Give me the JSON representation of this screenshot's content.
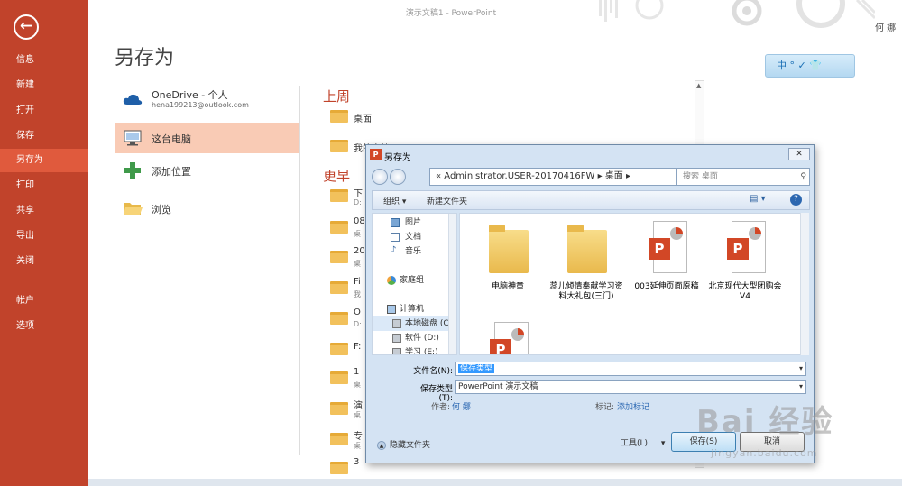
{
  "window": {
    "title": "演示文稿1 - PowerPoint",
    "user": "何 娜"
  },
  "sidebar": {
    "items": [
      {
        "label": "信息"
      },
      {
        "label": "新建"
      },
      {
        "label": "打开"
      },
      {
        "label": "保存"
      },
      {
        "label": "另存为",
        "active": true
      },
      {
        "label": "打印"
      },
      {
        "label": "共享"
      },
      {
        "label": "导出"
      },
      {
        "label": "关闭"
      },
      {
        "label": "帐户"
      },
      {
        "label": "选项"
      }
    ]
  },
  "page": {
    "title": "另存为"
  },
  "ime": {
    "label": "中 ° ✓ 👕"
  },
  "locations": {
    "onedrive": {
      "label": "OneDrive - 个人",
      "email": "hena199213@outlook.com"
    },
    "this_pc": {
      "label": "这台电脑"
    },
    "add_place": {
      "label": "添加位置"
    },
    "browse": {
      "label": "浏览"
    }
  },
  "folders": {
    "recent_week": {
      "title": "上周",
      "items": [
        {
          "name": "桌面"
        },
        {
          "name": "我的文档"
        }
      ]
    },
    "older": {
      "title": "更早",
      "items": [
        {
          "name": "下",
          "path": "D:"
        },
        {
          "name": "08",
          "path": "桌"
        },
        {
          "name": "20",
          "path": "桌"
        },
        {
          "name": "Fi",
          "path": "我"
        },
        {
          "name": "O",
          "path": "D:"
        },
        {
          "name": "F:",
          "path": ""
        },
        {
          "name": "1",
          "path": "桌"
        },
        {
          "name": "演",
          "path": "桌"
        },
        {
          "name": "专",
          "path": "桌"
        },
        {
          "name": "3",
          "path": ""
        }
      ]
    }
  },
  "dialog": {
    "title": "另存为",
    "address": "« Administrator.USER-20170416FW ▸ 桌面 ▸",
    "search_placeholder": "搜索 桌面",
    "toolbar": {
      "organize": "组织 ▾",
      "new_folder": "新建文件夹"
    },
    "nav": [
      {
        "label": "图片"
      },
      {
        "label": "文档"
      },
      {
        "label": "音乐"
      },
      {
        "label": "家庭组"
      },
      {
        "label": "计算机"
      },
      {
        "label": "本地磁盘 (C:"
      },
      {
        "label": "软件 (D:)"
      },
      {
        "label": "学习 (E:)"
      }
    ],
    "files": [
      {
        "name": "电脑神童",
        "type": "folder"
      },
      {
        "name": "蕊儿倾情奉献学习资料大礼包(三门)",
        "type": "folder"
      },
      {
        "name": "003延伸页面原稿",
        "type": "ppt"
      },
      {
        "name": "北京现代大型团购会 V4",
        "type": "ppt"
      },
      {
        "name": "",
        "type": "ppt"
      }
    ],
    "filename_label": "文件名(N):",
    "filename": "保存类型",
    "filetype_label": "保存类型(T):",
    "filetype": "PowerPoint 演示文稿",
    "author_label": "作者:",
    "author": "何 娜",
    "tags_label": "标记:",
    "tags": "添加标记",
    "hide_folders": "隐藏文件夹",
    "tools": "工具(L)",
    "save": "保存(S)",
    "cancel": "取消"
  },
  "watermark": {
    "main": "Bai 经验",
    "sub": "jingyan.baidu.com"
  },
  "colors": {
    "accent": "#c1432b",
    "active": "#e05a3d",
    "selected_location": "#f9cbb5",
    "link": "#2a67b2"
  }
}
